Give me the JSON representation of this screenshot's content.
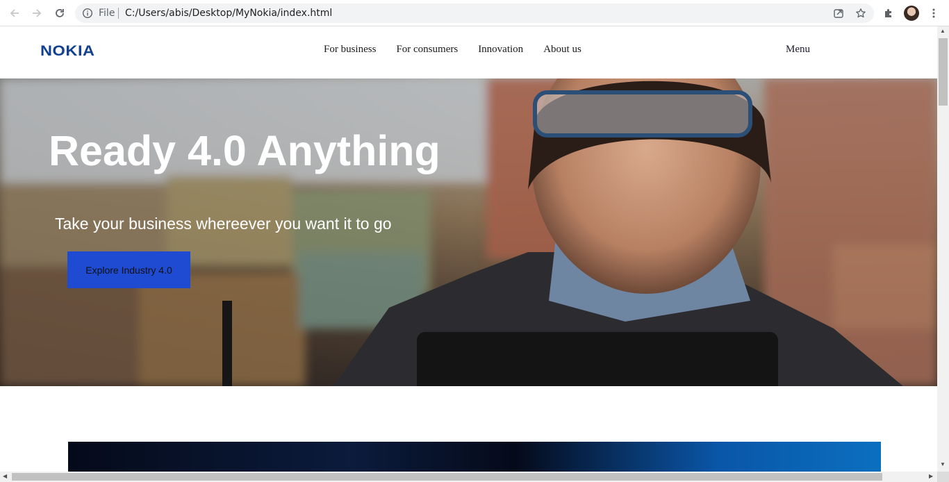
{
  "browser": {
    "omnibox_scheme": "File",
    "omnibox_url": "C:/Users/abis/Desktop/MyNokia/index.html",
    "icons": {
      "back": "arrow-left-icon",
      "forward": "arrow-right-icon",
      "reload": "reload-icon",
      "info": "info-icon",
      "share": "share-icon",
      "bookmark": "star-icon",
      "extensions": "puzzle-icon",
      "profile": "avatar",
      "more": "kebab-menu-icon"
    }
  },
  "site": {
    "logo": "NOKIA",
    "nav": [
      "For business",
      "For consumers",
      "Innovation",
      "About us"
    ],
    "menu_label": "Menu",
    "brand_color": "#124191"
  },
  "hero": {
    "title": "Ready 4.0 Anything",
    "subtitle": "Take your business whereever you want it to go",
    "cta_label": "Explore Industry 4.0",
    "cta_color": "#1e4bd2"
  }
}
